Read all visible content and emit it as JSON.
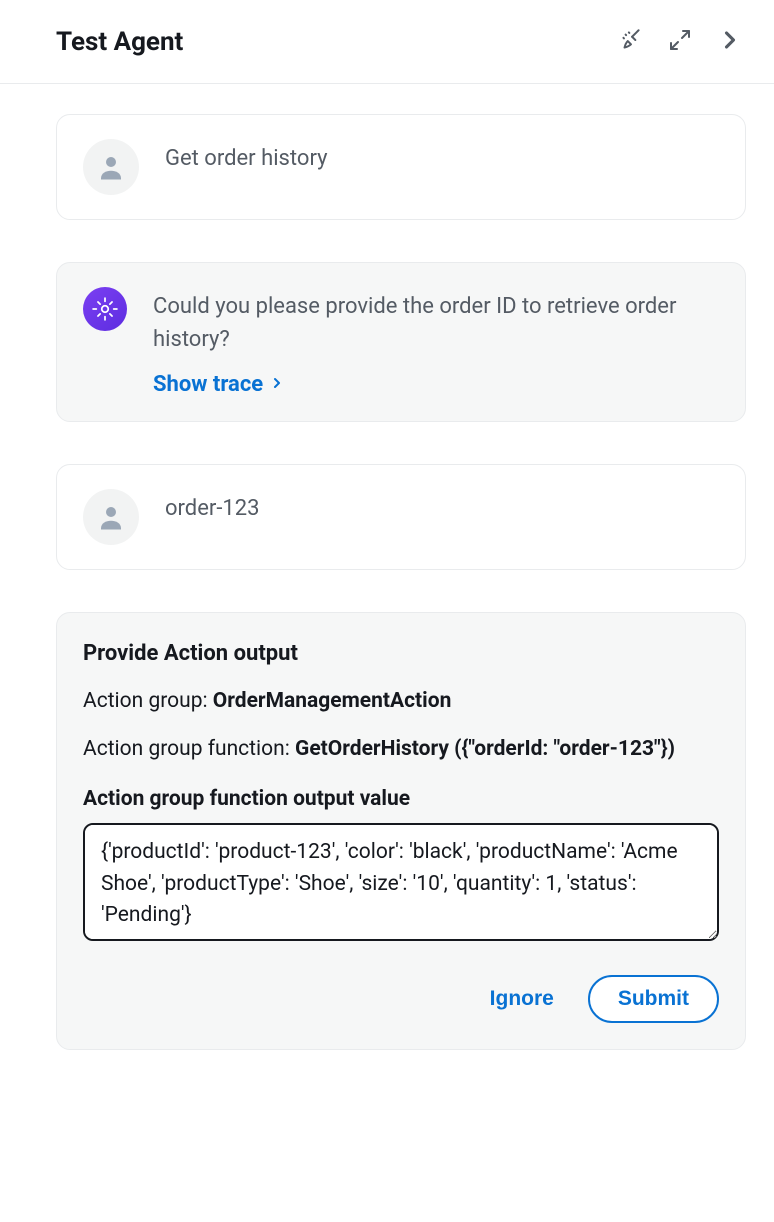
{
  "header": {
    "title": "Test Agent"
  },
  "messages": {
    "user1": "Get order history",
    "agent1": "Could you please provide the order ID to retrieve order history?",
    "trace_link": "Show trace",
    "user2": "order-123"
  },
  "action_panel": {
    "title": "Provide Action output",
    "group_label": "Action group: ",
    "group_value": "OrderManagementAction",
    "func_label": "Action group function: ",
    "func_value": "GetOrderHistory ({\"orderId: \"order-123\"})",
    "output_label": "Action group function output value",
    "output_value": "{'productId': 'product-123', 'color': 'black', 'productName': 'Acme Shoe', 'productType': 'Shoe', 'size': '10', 'quantity': 1, 'status': 'Pending'}",
    "ignore_label": "Ignore",
    "submit_label": "Submit"
  }
}
